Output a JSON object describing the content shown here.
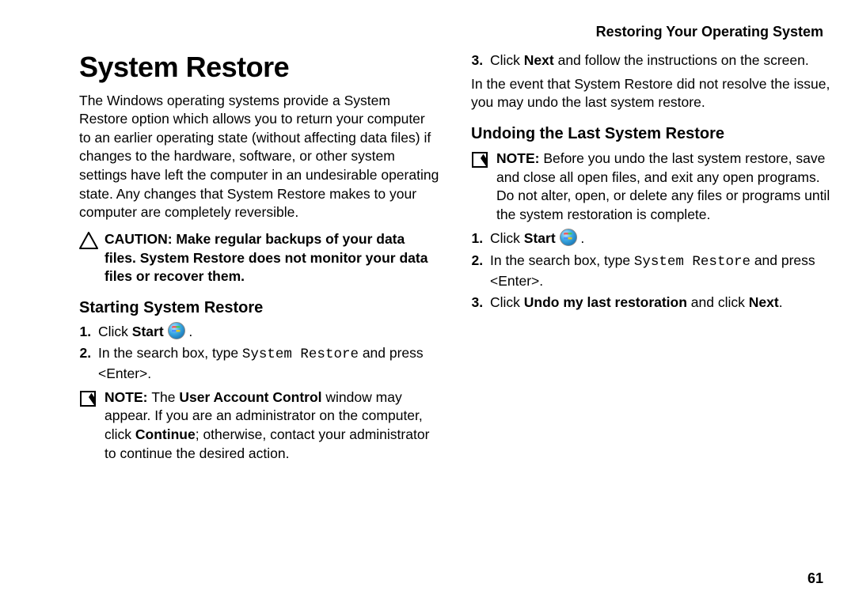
{
  "header": "Restoring Your Operating System",
  "title": "System Restore",
  "intro": "The Windows operating systems provide a System Restore option which allows you to return your computer to an earlier operating state (without affecting data files) if changes to the hardware, software, or other system settings have left the computer in an undesirable operating state. Any changes that System Restore makes to your computer are completely reversible.",
  "caution": {
    "label": "CAUTION: ",
    "text": "Make regular backups of your data files. System Restore does not monitor your data files or recover them."
  },
  "starting": {
    "heading": "Starting System Restore",
    "step1_pre": "Click ",
    "step1_bold": "Start",
    "step2_pre": "In the search box, type ",
    "step2_mono": "System Restore",
    "step2_post": " and press <Enter>.",
    "note_label": "NOTE: ",
    "note_pre": "The ",
    "note_bold1": "User Account Control",
    "note_mid": " window may appear. If you are an administrator on the computer, click ",
    "note_bold2": "Continue",
    "note_post": "; otherwise, contact your administrator to continue the desired action."
  },
  "col2_step3_pre": "Click ",
  "col2_step3_bold": "Next",
  "col2_step3_post": " and follow the instructions on the screen.",
  "col2_para": "In the event that System Restore did not resolve the issue, you may undo the last system restore.",
  "undo": {
    "heading": "Undoing the Last System Restore",
    "note_label": "NOTE: ",
    "note_text": "Before you undo the last system restore, save and close all open files, and exit any open programs. Do not alter, open, or delete any files or programs until the system restoration is complete.",
    "step1_pre": "Click ",
    "step1_bold": "Start",
    "step2_pre": "In the search box, type ",
    "step2_mono": "System Restore",
    "step2_post": " and press <Enter>.",
    "step3_pre": "Click ",
    "step3_bold1": "Undo my last restoration",
    "step3_mid": " and click ",
    "step3_bold2": "Next",
    "step3_post": "."
  },
  "page_number": "61"
}
